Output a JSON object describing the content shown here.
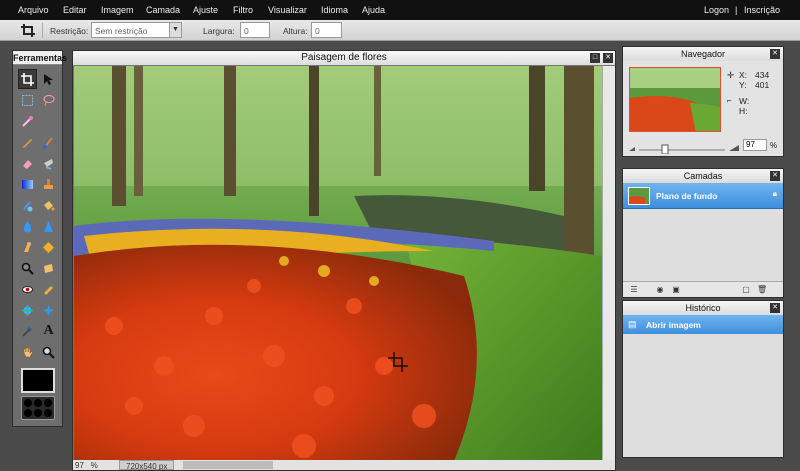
{
  "menubar": {
    "items": [
      "Arquivo",
      "Editar",
      "Imagem",
      "Camada",
      "Ajuste",
      "Filtro",
      "Visualizar",
      "Idioma",
      "Ajuda"
    ],
    "login": "Logon",
    "separator": "|",
    "register": "Inscrição"
  },
  "options": {
    "restriction_label": "Restrição:",
    "restriction_value": "Sem restrição",
    "width_label": "Largura:",
    "width_value": "0",
    "height_label": "Altura:",
    "height_value": "0"
  },
  "toolbox": {
    "title": "Ferramentas"
  },
  "image_window": {
    "title": "Paisagem de flores",
    "zoom": "97",
    "zoom_unit": "%",
    "dimensions": "720x540 px"
  },
  "navigator": {
    "title": "Navegador",
    "x_label": "X:",
    "x_value": "434",
    "y_label": "Y:",
    "y_value": "401",
    "w_label": "W:",
    "h_label": "H:",
    "zoom_value": "97",
    "zoom_unit": "%"
  },
  "layers": {
    "title": "Camadas",
    "items": [
      {
        "name": "Plano de fundo"
      }
    ]
  },
  "history": {
    "title": "Histórico",
    "items": [
      {
        "name": "Abrir imagem"
      }
    ]
  },
  "colors": {
    "accent": "#3e8fdc",
    "menubar": "#111111"
  }
}
